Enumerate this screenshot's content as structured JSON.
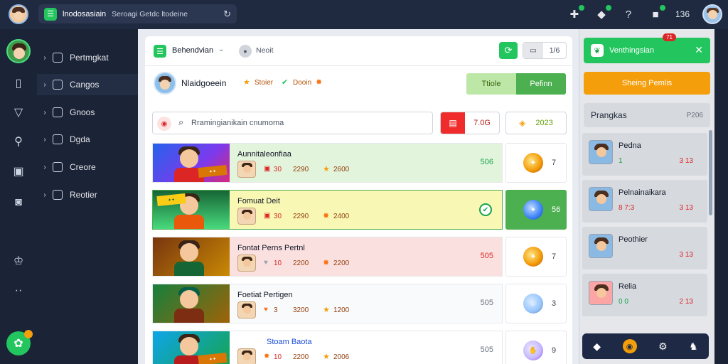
{
  "topbar": {
    "address_title": "lnodosasiain",
    "address_sub": "Seroagi Getdc ltodeine",
    "reload_icon": "↻",
    "right_count": "136"
  },
  "sidenav": {
    "items": [
      {
        "label": "Pertmgkat"
      },
      {
        "label": "Cangos"
      },
      {
        "label": "Gnoos"
      },
      {
        "label": "Dgda"
      },
      {
        "label": "Creore"
      },
      {
        "label": "Reotier"
      }
    ]
  },
  "card": {
    "header": {
      "title": "Behendvian",
      "dropdown": "⌄",
      "pill": "Neoit",
      "seg_value": "1/6"
    },
    "profile": {
      "name": "Nlaidgoeein",
      "stat1_label": "Stoier",
      "stat2_label": "Dooin",
      "tab1": "Ttiole",
      "tab2": "Pefinn"
    },
    "search": {
      "placeholder": "Rramingianikain cnumoma"
    },
    "filter": {
      "value": "7.0G"
    },
    "coins": {
      "value": "2023"
    },
    "rows": [
      {
        "title": "Aunnitaleonfiaa",
        "m1": "30",
        "m2": "2290",
        "m3": "2600",
        "score": "506",
        "side": "7"
      },
      {
        "title": "Fomuat  Deit",
        "m1": "30",
        "m2": "2290",
        "m3": "2400",
        "score": "",
        "side": "56"
      },
      {
        "title": "Fontat  Perns Pertnl",
        "m1": "10",
        "m2": "2200",
        "m3": "2200",
        "score": "505",
        "side": "7"
      },
      {
        "title": "Foetiat  Pertigen",
        "m1": "3",
        "m2": "3200",
        "m3": "1200",
        "score": "505",
        "side": "3"
      },
      {
        "title": "Stoam Baota",
        "m1": "10",
        "m2": "2200",
        "m3": "2006",
        "score": "505",
        "side": "9"
      }
    ]
  },
  "rightpanel": {
    "header": "Venthingsian",
    "badge": "71",
    "orange_button": "Sheing Pemlis",
    "sub_title": "Prangkas",
    "sub_value": "P206",
    "items": [
      {
        "name": "Pedna",
        "left": "1",
        "right": "3 13"
      },
      {
        "name": "Pelnainaikara",
        "left": "8 7:3",
        "right": "3 13"
      },
      {
        "name": "Peothier",
        "left": "",
        "right": "3 13"
      },
      {
        "name": "Relia",
        "left": "0 0",
        "right": "2 13"
      }
    ]
  },
  "colors": {
    "accent": "#22c55e",
    "orange": "#f59e0b",
    "red": "#ef2b2b",
    "dark": "#1b2336"
  }
}
